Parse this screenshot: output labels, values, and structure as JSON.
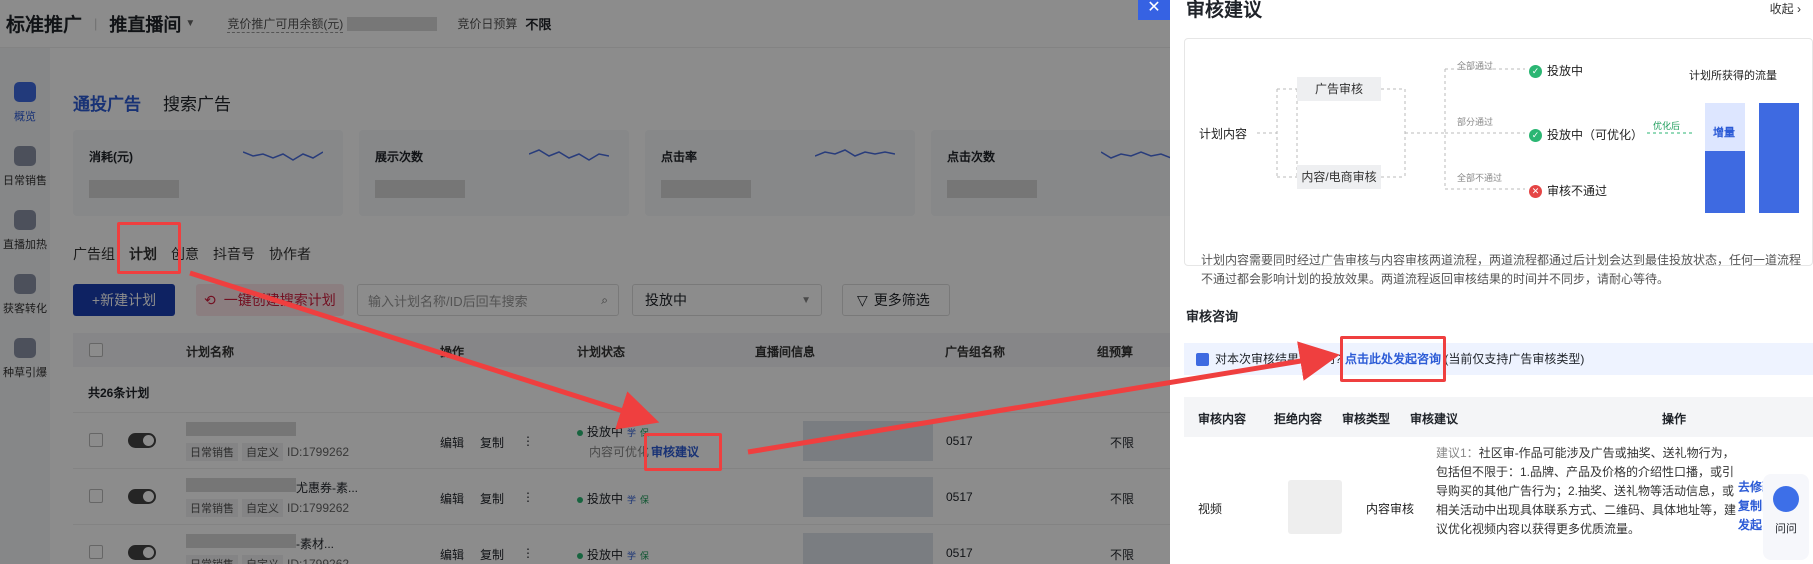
{
  "app": {
    "brand": "标准推广",
    "module": "推直播间",
    "balance_label": "竞价推广可用余额(元)",
    "budget_label": "竞价日预算",
    "budget_value": "不限"
  },
  "sidebar": {
    "items": [
      {
        "label": "概览"
      },
      {
        "label": "日常销售"
      },
      {
        "label": "直播加热"
      },
      {
        "label": "获客转化"
      },
      {
        "label": "种草引爆"
      }
    ]
  },
  "main_tabs": [
    "通投广告",
    "搜索广告"
  ],
  "metrics": [
    {
      "label": "消耗(元)"
    },
    {
      "label": "展示次数"
    },
    {
      "label": "点击率"
    },
    {
      "label": "点击次数"
    }
  ],
  "sub_tabs": [
    "广告组",
    "计划",
    "创意",
    "抖音号",
    "协作者"
  ],
  "toolbar": {
    "new_plan": "+新建计划",
    "create_search": "一键创建搜索计划",
    "search_placeholder": "输入计划名称/ID后回车搜索",
    "status_value": "投放中",
    "more_filter": "更多筛选"
  },
  "table": {
    "headers": [
      "计划名称",
      "操作",
      "计划状态",
      "直播间信息",
      "广告组名称",
      "组预算"
    ],
    "count_label": "共26条计划",
    "rows": [
      {
        "tag1": "日常销售",
        "tag2": "自定义",
        "id": "ID:1799262",
        "edit": "编辑",
        "copy": "复制",
        "status": "投放中",
        "pill1": "学",
        "pill2": "保",
        "sub": "内容可优化",
        "link": "审核建议",
        "group": "0517",
        "budget": "不限",
        "name_suffix": ""
      },
      {
        "tag1": "日常销售",
        "tag2": "自定义",
        "id": "ID:1799262",
        "edit": "编辑",
        "copy": "复制",
        "status": "投放中",
        "pill1": "学",
        "pill2": "保",
        "sub": "",
        "link": "",
        "group": "0517",
        "budget": "不限",
        "name_suffix": "尤惠券-素..."
      },
      {
        "tag1": "日常销售",
        "tag2": "自定义",
        "id": "ID:1799262",
        "edit": "编辑",
        "copy": "复制",
        "status": "投放中",
        "pill1": "学",
        "pill2": "保",
        "sub": "",
        "link": "",
        "group": "0517",
        "budget": "不限",
        "name_suffix": "-素材..."
      }
    ]
  },
  "drawer": {
    "title": "审核建议",
    "collapse": "收起",
    "flow": {
      "plan_content": "计划内容",
      "ad_review": "广告审核",
      "content_review": "内容/电商审核",
      "all_pass": "全部通过",
      "partial_pass": "部分通过",
      "all_fail": "全部不通过",
      "delivering": "投放中",
      "delivering_opt": "投放中（可优化）",
      "not_pass": "审核不通过",
      "traffic_title": "计划所获得的流量",
      "optimize_after": "优化后",
      "increment": "增量",
      "desc": "计划内容需要同时经过广告审核与内容审核两道流程，两道流程都通过后计划会达到最佳投放状态，任何一道流程不通过都会影响计划的投放效果。两道流程返回审核结果的时间并不同步，请耐心等待。"
    },
    "consult": {
      "section_title": "审核咨询",
      "question": "对本次审核结果有疑问?",
      "link": "点击此处发起咨询",
      "note": "(当前仅支持广告审核类型)"
    },
    "table": {
      "headers": [
        "审核内容",
        "拒绝内容",
        "审核类型",
        "审核建议",
        "操作"
      ],
      "content": "视频",
      "type": "内容审核",
      "advice_prefix": "建议1：",
      "advice": "社区审-作品可能涉及广告或抽奖、送礼物行为，包括但不限于：1.品牌、产品及价格的介绍性口播，或引导购买的其他广告行为；2.抽奖、送礼物等活动信息，或相关活动中出现具体联系方式、二维码、具体地址等，建议优化视频内容以获得更多优质流量。",
      "ops": [
        "去修改",
        "复制内",
        "发起申"
      ]
    },
    "bot_label": "问问"
  },
  "colors": {
    "accent": "#2c5bd6",
    "annotation": "#ef3f3f",
    "success": "#2bb673",
    "danger": "#e54545"
  }
}
